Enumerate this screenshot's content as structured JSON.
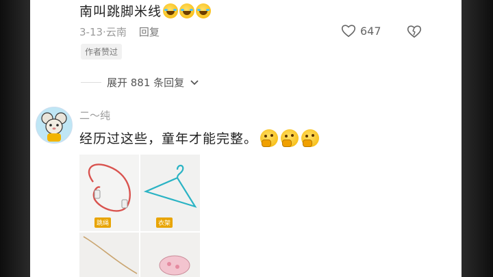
{
  "reply": {
    "text": "南叫跳脚米线",
    "emoji": "laughing-crying-emoji",
    "date": "3-13",
    "location": "云南",
    "reply_label": "回复",
    "like_count": "647",
    "author_badge": "作者赞过",
    "expand_label": "展开 881 条回复"
  },
  "comment": {
    "username": "二～纯",
    "text": "经历过这些，童年才能完整。",
    "emoji": "thinking-emoji",
    "photo_tags": [
      "跳绳",
      "衣架"
    ]
  },
  "colors": {
    "accent_gray": "#9a9a9a",
    "badge_bg": "#f1f1f1",
    "tag_bg": "#e8a400"
  }
}
